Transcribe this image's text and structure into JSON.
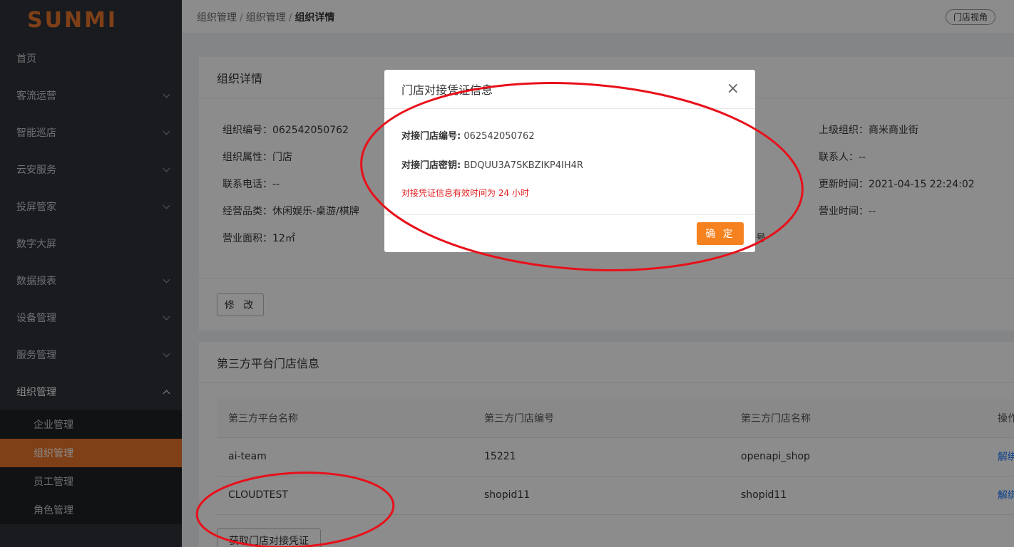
{
  "sidebar": {
    "logo": "SUNMI",
    "items": [
      {
        "label": "首页",
        "chevron": false
      },
      {
        "label": "客流运营",
        "chevron": true
      },
      {
        "label": "智能巡店",
        "chevron": true
      },
      {
        "label": "云安服务",
        "chevron": true
      },
      {
        "label": "投屏管家",
        "chevron": true
      },
      {
        "label": "数字大屏",
        "chevron": false
      },
      {
        "label": "数据报表",
        "chevron": true
      },
      {
        "label": "设备管理",
        "chevron": true
      },
      {
        "label": "服务管理",
        "chevron": true
      },
      {
        "label": "组织管理",
        "chevron": true,
        "open": true
      }
    ],
    "sub_items": [
      {
        "label": "企业管理"
      },
      {
        "label": "组织管理",
        "active": true
      },
      {
        "label": "员工管理"
      },
      {
        "label": "角色管理"
      }
    ]
  },
  "header": {
    "breadcrumb": [
      "组织管理",
      "组织管理",
      "组织详情"
    ],
    "separator": "/",
    "view_button": "门店视角"
  },
  "detail": {
    "title": "组织详情",
    "fields": {
      "org_no": {
        "label": "组织编号：",
        "value": "062542050762"
      },
      "org_attr": {
        "label": "组织属性：",
        "value": "门店"
      },
      "phone": {
        "label": "联系电话：",
        "value": "--"
      },
      "category": {
        "label": "经营品类：",
        "value": "休闲娱乐-桌游/棋牌"
      },
      "area": {
        "label": "营业面积：",
        "value": "12㎡"
      },
      "parent": {
        "label": "上级组织：",
        "value": "商米商业街"
      },
      "contact": {
        "label": "联系人：",
        "value": "--"
      },
      "updated": {
        "label": "更新时间：",
        "value": "2021-04-15 22:24:02"
      },
      "hours": {
        "label": "营业时间：",
        "value": "--"
      },
      "partial": "号"
    },
    "edit_button": "修 改"
  },
  "third_party": {
    "title": "第三方平台门店信息",
    "columns": [
      "第三方平台名称",
      "第三方门店编号",
      "第三方门店名称",
      "操作"
    ],
    "rows": [
      {
        "platform": "ai-team",
        "store_no": "15221",
        "store_name": "openapi_shop",
        "op": "解绑"
      },
      {
        "platform": "CLOUDTEST",
        "store_no": "shopid11",
        "store_name": "shopid11",
        "op": "解绑"
      }
    ],
    "credential_button": "获取门店对接凭证"
  },
  "modal": {
    "title": "门店对接凭证信息",
    "close": "×",
    "store_no_label": "对接门店编号:",
    "store_no_value": "062542050762",
    "key_label": "对接门店密钥:",
    "key_value": "BDQUU3A7SKBZIKP4IH4R",
    "warning": "对接凭证信息有效时间为 24 小时",
    "ok_button": "确 定"
  },
  "colors": {
    "accent": "#f5821f",
    "sidebar_bg": "#2e3239",
    "warning": "#e02020",
    "link": "#1677ff",
    "annotation": "#e8101a"
  }
}
